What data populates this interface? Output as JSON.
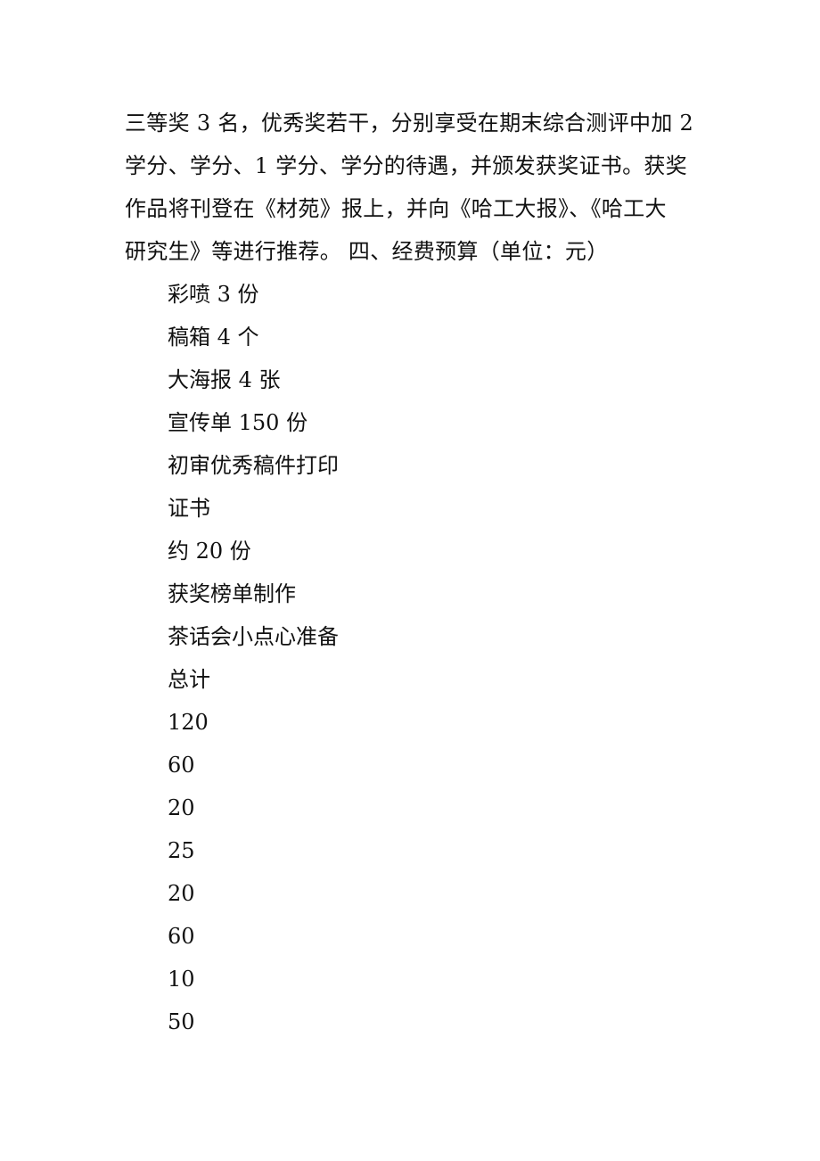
{
  "paragraph": {
    "lines": [
      "三等奖 3 名，优秀奖若干，分别享受在期末综合测评中加 2",
      "学分、学分、1 学分、学分的待遇，并颁发获奖证书。获奖",
      "作品将刊登在《材苑》报上，并向《哈工大报》、《哈工大",
      "研究生》等进行推荐。 四、经费预算（单位：元）"
    ]
  },
  "budget_items": [
    "彩喷 3 份",
    "稿箱 4 个",
    "大海报 4 张",
    "宣传单 150 份",
    "初审优秀稿件打印",
    "证书",
    "约 20 份",
    "获奖榜单制作",
    "茶话会小点心准备",
    "总计"
  ],
  "budget_amounts": [
    "120",
    "60",
    "20",
    "25",
    "20",
    "60",
    "10",
    "50"
  ]
}
